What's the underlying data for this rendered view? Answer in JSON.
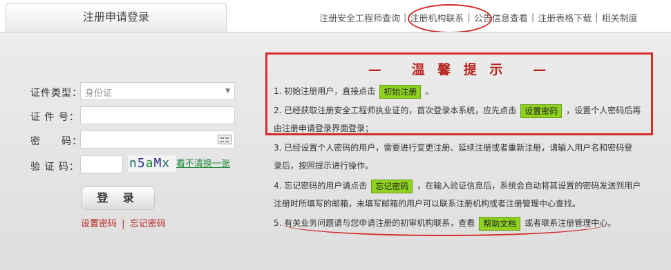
{
  "tab": {
    "title": "注册申请登录"
  },
  "top_nav": [
    {
      "label": "注册安全工程师查询"
    },
    {
      "label": "注册机构联系"
    },
    {
      "label": "公告信息查看"
    },
    {
      "label": "注册表格下载"
    },
    {
      "label": "相关制度"
    }
  ],
  "top_nav_sep": "|",
  "form": {
    "id_type_label": "证件类型：",
    "id_type_value": "身份证",
    "id_no_label": "证 件 号：",
    "password_label": "密　　码：",
    "captcha_label": "验 证 码：",
    "captcha_chars": [
      "n",
      "5",
      "a",
      "M",
      "x"
    ],
    "refresh_label": "看不清换一张",
    "login_label": "登 录",
    "set_password_label": "设置密码",
    "link_sep": "|",
    "forgot_password_label": "忘记密码"
  },
  "notice": {
    "title": "—   温 馨 提 示   —",
    "item1_pre": "1. 初始注册用户，直接点击",
    "item1_btn": "初始注册",
    "item1_post": "。",
    "item2_pre": "2. 已经获取注册安全工程师执业证的，首次登录本系统，应先点击",
    "item2_btn": "设置密码",
    "item2_post": "，设置个人密码后再",
    "item2_line2": "由注册申请登录界面登录；",
    "item3_line1": "3. 已经设置个人密码的用户，需要进行变更注册、延续注册或者重新注册，请输入用户名和密码登",
    "item3_line2": "录后，按照提示进行操作。",
    "item4_pre": "4. 忘记密码的用户请点击",
    "item4_btn": "忘记密码",
    "item4_post": "，在输入验证信息后，系统会自动将其设置的密码发送到用户",
    "item4_line2": "注册时所填写的邮箱，未填写邮箱的用户可以联系注册机构或者注册管理中心查找。",
    "item5_pre": "5. 有关业务问题请与您申请注册的初审机构联系，查看",
    "item5_btn": "帮助文档",
    "item5_post": "或者联系注册管理中心。"
  },
  "colors": {
    "annotation": "#d42a2a",
    "button_green": "#8fd320",
    "title_red": "#b8241d"
  }
}
